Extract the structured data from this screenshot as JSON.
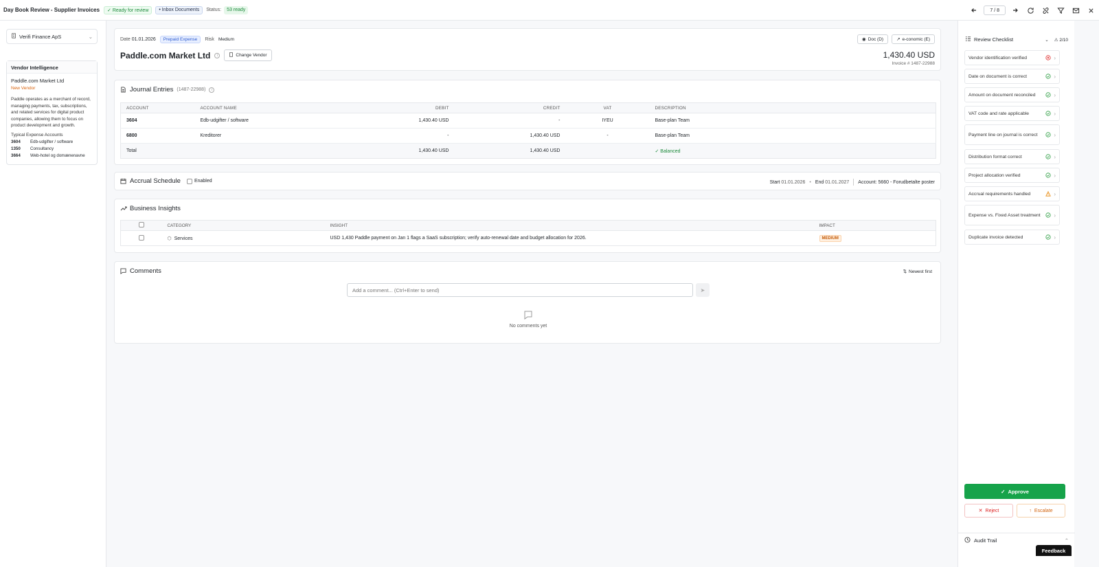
{
  "header": {
    "title": "Day Book Review - Supplier Invoices",
    "ready_badge": "✓ Ready for review",
    "inbox_badge": "• Inbox Documents",
    "status_label": "Status:",
    "status_value": "53 ready",
    "pager": "7 / 8"
  },
  "sidebar": {
    "company": "Verifi Finance ApS",
    "vendor_intel": {
      "title": "Vendor Intelligence",
      "vendor_name": "Paddle.com Market Ltd",
      "new_vendor": "New Vendor",
      "description": "Paddle operates as a merchant of record, managing payments, tax, subscriptions, and related services for digital product companies, allowing them to focus on product development and growth.",
      "typical_title": "Typical Expense Accounts",
      "accounts": [
        {
          "no": "3604",
          "name": "Edb-udgifter / software"
        },
        {
          "no": "1350",
          "name": "Consultancy"
        },
        {
          "no": "3664",
          "name": "Web-hotel og domænenavne"
        }
      ]
    }
  },
  "invoice": {
    "date_label": "Date",
    "date": "01.01.2026",
    "tag": "Prepaid Expense",
    "risk_label": "Risk",
    "risk": "Medium",
    "vendor": "Paddle.com Market Ltd",
    "change_vendor": "Change Vendor",
    "doc_btn": "Doc (D)",
    "economic_btn": "e-conomic (E)",
    "amount": "1,430.40 USD",
    "invoice_no": "Invoice # 1487-22988"
  },
  "journal": {
    "title": "Journal Entries",
    "ref": "(1487-22988)",
    "headers": [
      "ACCOUNT",
      "ACCOUNT NAME",
      "DEBIT",
      "CREDIT",
      "VAT",
      "DESCRIPTION"
    ],
    "rows": [
      {
        "account": "3604",
        "name": "Edb-udgifter / software",
        "debit": "1,430.40 USD",
        "credit": "-",
        "vat": "IYEU",
        "desc": "Base-plan Team"
      },
      {
        "account": "6800",
        "name": "Kreditorer",
        "debit": "-",
        "credit": "1,430.40 USD",
        "vat": "-",
        "desc": "Base-plan Team"
      }
    ],
    "total": {
      "label": "Total",
      "debit": "1,430.40 USD",
      "credit": "1,430.40 USD",
      "status": "✓ Balanced"
    }
  },
  "accrual": {
    "title": "Accrual Schedule",
    "enabled_label": "Enabled",
    "start_label": "Start",
    "start": "01.01.2026",
    "dot": "•",
    "end_label": "End",
    "end": "01.01.2027",
    "account_label": "Account:",
    "account": "5660 - Forudbetalte poster"
  },
  "insights": {
    "title": "Business Insights",
    "headers": [
      "CATEGORY",
      "INSIGHT",
      "IMPACT"
    ],
    "rows": [
      {
        "category": "Services",
        "insight": "USD 1,430 Paddle payment on Jan 1 flags a SaaS subscription; verify auto-renewal date and budget allocation for 2026.",
        "impact": "MEDIUM"
      }
    ]
  },
  "comments": {
    "title": "Comments",
    "sort": "Newest first",
    "placeholder": "Add a comment... (Ctrl+Enter to send)",
    "empty": "No comments yet"
  },
  "checklist": {
    "title": "Review Checklist",
    "count": "2/10",
    "items": [
      {
        "label": "Vendor identification verified",
        "status": "fail"
      },
      {
        "label": "Date on document is correct",
        "status": "ok"
      },
      {
        "label": "Amount on document reconciled",
        "status": "ok"
      },
      {
        "label": "VAT code and rate applicable",
        "status": "ok"
      },
      {
        "label": "Payment line on journal is correct",
        "status": "ok"
      },
      {
        "label": "Distribution format correct",
        "status": "ok"
      },
      {
        "label": "Project allocation verified",
        "status": "ok"
      },
      {
        "label": "Accrual requirements handled",
        "status": "warn"
      },
      {
        "label": "Expense vs. Fixed Asset treatment",
        "status": "ok"
      },
      {
        "label": "Duplicate invoice detected",
        "status": "ok"
      }
    ],
    "approve": "Approve",
    "reject": "Reject",
    "escalate": "Escalate",
    "audit": "Audit Trail"
  },
  "feedback": "Feedback",
  "colors": {
    "accent_green": "#16a34a",
    "fail": "#e03131",
    "warn": "#e8890c",
    "ok": "#2f9e44"
  }
}
